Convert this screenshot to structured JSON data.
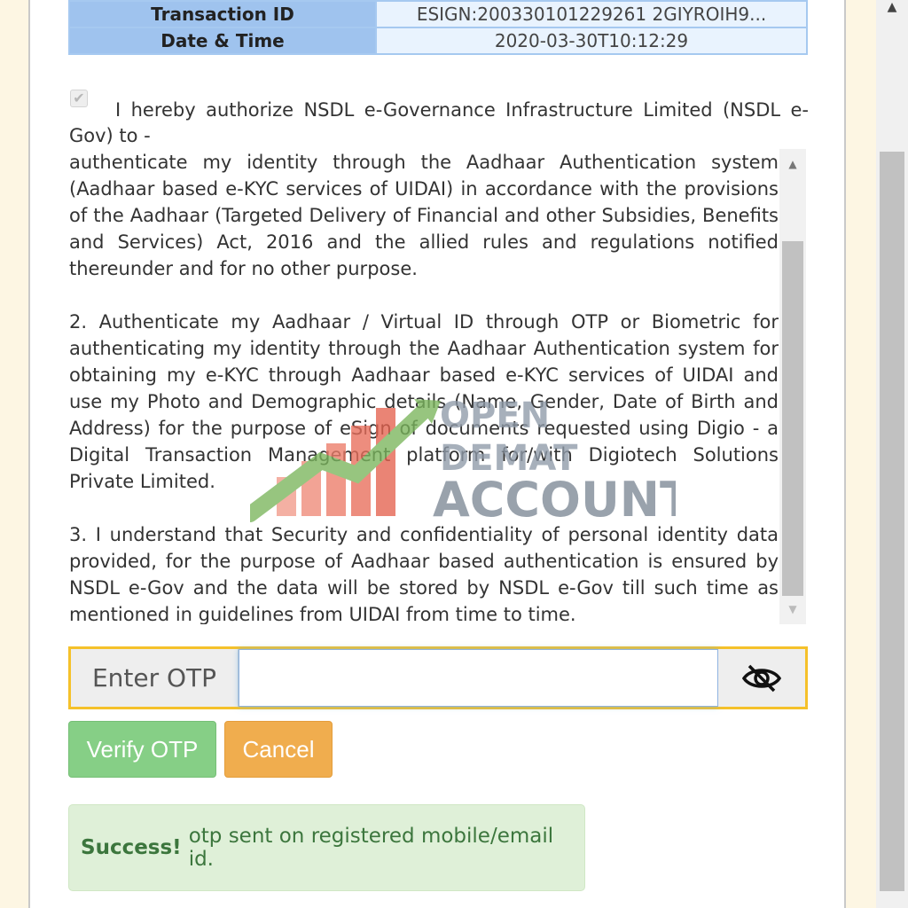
{
  "transaction_table": {
    "rows": [
      {
        "label": "Transaction ID",
        "value": "ESIGN:200330101229261 2GIYROIH9..."
      },
      {
        "label": "Date & Time",
        "value": "2020-03-30T10:12:29"
      }
    ]
  },
  "consent": {
    "checked": true,
    "intro": "I hereby authorize NSDL e-Governance Infrastructure Limited (NSDL e-Gov) to -",
    "paragraphs": [
      "authenticate my identity through the Aadhaar Authentication system (Aadhaar based e-KYC services of UIDAI) in accordance with the provisions of the Aadhaar (Targeted Delivery of Financial and other Subsidies, Benefits and Services) Act, 2016 and the allied rules and regulations notified thereunder and for no other purpose.",
      "2. Authenticate my Aadhaar / Virtual ID through OTP or Biometric for authenticating my identity through the Aadhaar Authentication system for obtaining my e-KYC through Aadhaar based e-KYC services of UIDAI and use my Photo and Demographic details (Name, Gender, Date of Birth and Address) for the purpose of eSign of documents requested using Digio - a Digital Transaction Management platform for/with Digiotech Solutions Private Limited.",
      "3. I understand that Security and confidentiality of personal identity data provided, for the purpose of Aadhaar based authentication is ensured by NSDL e-Gov and the data will be stored by NSDL e-Gov till such time as mentioned in guidelines from UIDAI from time to time."
    ]
  },
  "watermark": {
    "line1": "OPEN",
    "line2": "DEMAT",
    "line3": "ACCOUNT"
  },
  "otp": {
    "label": "Enter OTP",
    "value": "",
    "toggle_icon": "eye-slash-icon"
  },
  "buttons": {
    "verify": "Verify OTP",
    "cancel": "Cancel"
  },
  "alert": {
    "strong": "Success!",
    "message": "otp sent on registered mobile/email id."
  },
  "colors": {
    "header_cell": "#9fc3ee",
    "value_cell": "#e9f3fe",
    "otp_highlight": "#f5c12a",
    "verify_button": "#86cf86",
    "cancel_button": "#f0ad4e",
    "alert_bg": "#dff0d8",
    "alert_text": "#3c763d"
  }
}
